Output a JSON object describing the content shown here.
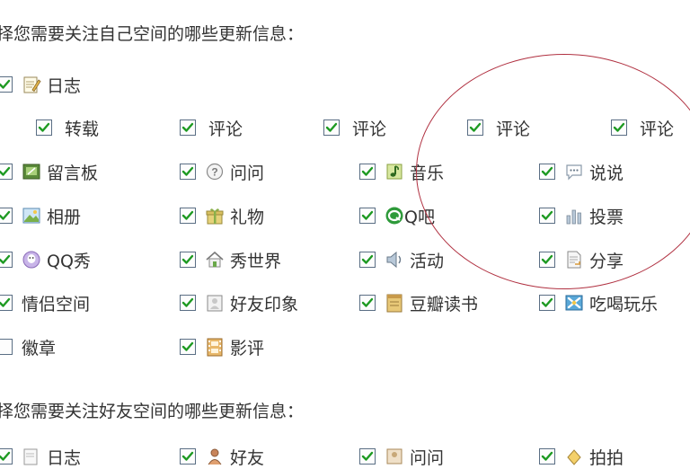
{
  "section1": {
    "heading": "择您需要关注自己空间的哪些更新信息："
  },
  "section2": {
    "heading": "择您需要关注好友空间的哪些更新信息："
  },
  "items": [
    {
      "label": "日志",
      "checked": true,
      "icon": "diary-icon"
    },
    {
      "label": "转载",
      "checked": true,
      "icon": ""
    },
    {
      "label": "评论",
      "checked": true,
      "icon": ""
    },
    {
      "label": "评论",
      "checked": true,
      "icon": ""
    },
    {
      "label": "评论",
      "checked": true,
      "icon": ""
    },
    {
      "label": "评论",
      "checked": true,
      "icon": ""
    },
    {
      "label": "留言板",
      "checked": true,
      "icon": "message-board-icon"
    },
    {
      "label": "问问",
      "checked": true,
      "icon": "question-icon"
    },
    {
      "label": "音乐",
      "checked": true,
      "icon": "music-icon"
    },
    {
      "label": "说说",
      "checked": true,
      "icon": "speech-bubble-icon"
    },
    {
      "label": "相册",
      "checked": true,
      "icon": "photo-album-icon"
    },
    {
      "label": "礼物",
      "checked": true,
      "icon": "gift-icon"
    },
    {
      "label": "Q吧",
      "checked": true,
      "icon": "qbar-icon"
    },
    {
      "label": "投票",
      "checked": true,
      "icon": "vote-bar-chart-icon"
    },
    {
      "label": "QQ秀",
      "checked": true,
      "icon": "qq-show-icon"
    },
    {
      "label": "秀世界",
      "checked": true,
      "icon": "house-icon"
    },
    {
      "label": "活动",
      "checked": true,
      "icon": "speaker-icon"
    },
    {
      "label": "分享",
      "checked": true,
      "icon": "share-document-icon"
    },
    {
      "label": "情侣空间",
      "checked": true,
      "icon": ""
    },
    {
      "label": "好友印象",
      "checked": true,
      "icon": "impression-icon"
    },
    {
      "label": "豆瓣读书",
      "checked": true,
      "icon": "book-icon"
    },
    {
      "label": "吃喝玩乐",
      "checked": true,
      "icon": "fun-icon"
    },
    {
      "label": "徽章",
      "checked": false,
      "icon": ""
    },
    {
      "label": "影评",
      "checked": true,
      "icon": "film-icon"
    },
    {
      "label": "日志",
      "checked": true,
      "icon": "diary-icon"
    },
    {
      "label": "好友",
      "checked": true,
      "icon": "friend-icon"
    },
    {
      "label": "问问",
      "checked": true,
      "icon": "question-icon"
    },
    {
      "label": "拍拍",
      "checked": true,
      "icon": "paipai-icon"
    }
  ]
}
